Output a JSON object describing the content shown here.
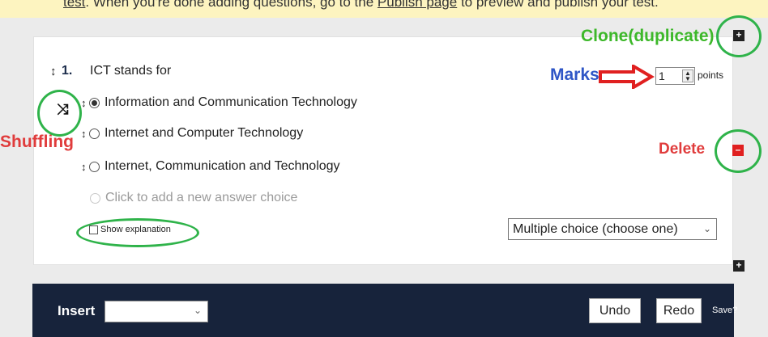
{
  "notice": {
    "pre": "test",
    "mid": ". When you're done adding questions, go to the ",
    "link": "Publish page",
    "post": " to preview and publish your test."
  },
  "question": {
    "number": "1.",
    "text": "ICT stands for",
    "choices": [
      {
        "label": "Information and Communication Technology",
        "selected": true
      },
      {
        "label": "Internet and Computer Technology",
        "selected": false
      },
      {
        "label": "Internet, Communication and Technology",
        "selected": false
      }
    ],
    "add_choice": "Click to add a new answer choice",
    "marks_value": "1",
    "points_label": "points",
    "show_explanation": "Show explanation",
    "type_selected": "Multiple choice (choose one)"
  },
  "annotations": {
    "clone": "Clone(duplicate)",
    "marks": "Marks",
    "delete": "Delete",
    "shuffling": "Shuffling"
  },
  "toolbar": {
    "insert_label": "Insert",
    "undo_label": "Undo",
    "redo_label": "Redo",
    "save_label": "Save?"
  },
  "colors": {
    "notice_bg": "#fdf4c0",
    "bar_bg": "#17233b",
    "annotation_green": "#3db82a",
    "annotation_red": "#e03c3c",
    "annotation_blue": "#2f56c6"
  }
}
